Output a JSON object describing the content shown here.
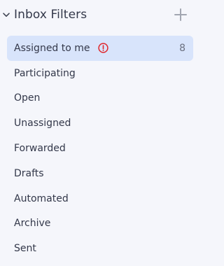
{
  "header": {
    "title": "Inbox Filters",
    "collapse_icon": "chevron-down-icon",
    "add_icon": "plus-icon"
  },
  "filters": [
    {
      "label": "Assigned to me",
      "count": "8",
      "active": true,
      "alert": true
    },
    {
      "label": "Participating"
    },
    {
      "label": "Open"
    },
    {
      "label": "Unassigned"
    },
    {
      "label": "Forwarded"
    },
    {
      "label": "Drafts"
    },
    {
      "label": "Automated"
    },
    {
      "label": "Archive"
    },
    {
      "label": "Sent"
    }
  ],
  "colors": {
    "background": "#f5f6fb",
    "active_background": "#d8e4fb",
    "alert": "#e0262b",
    "text": "#33384a"
  }
}
